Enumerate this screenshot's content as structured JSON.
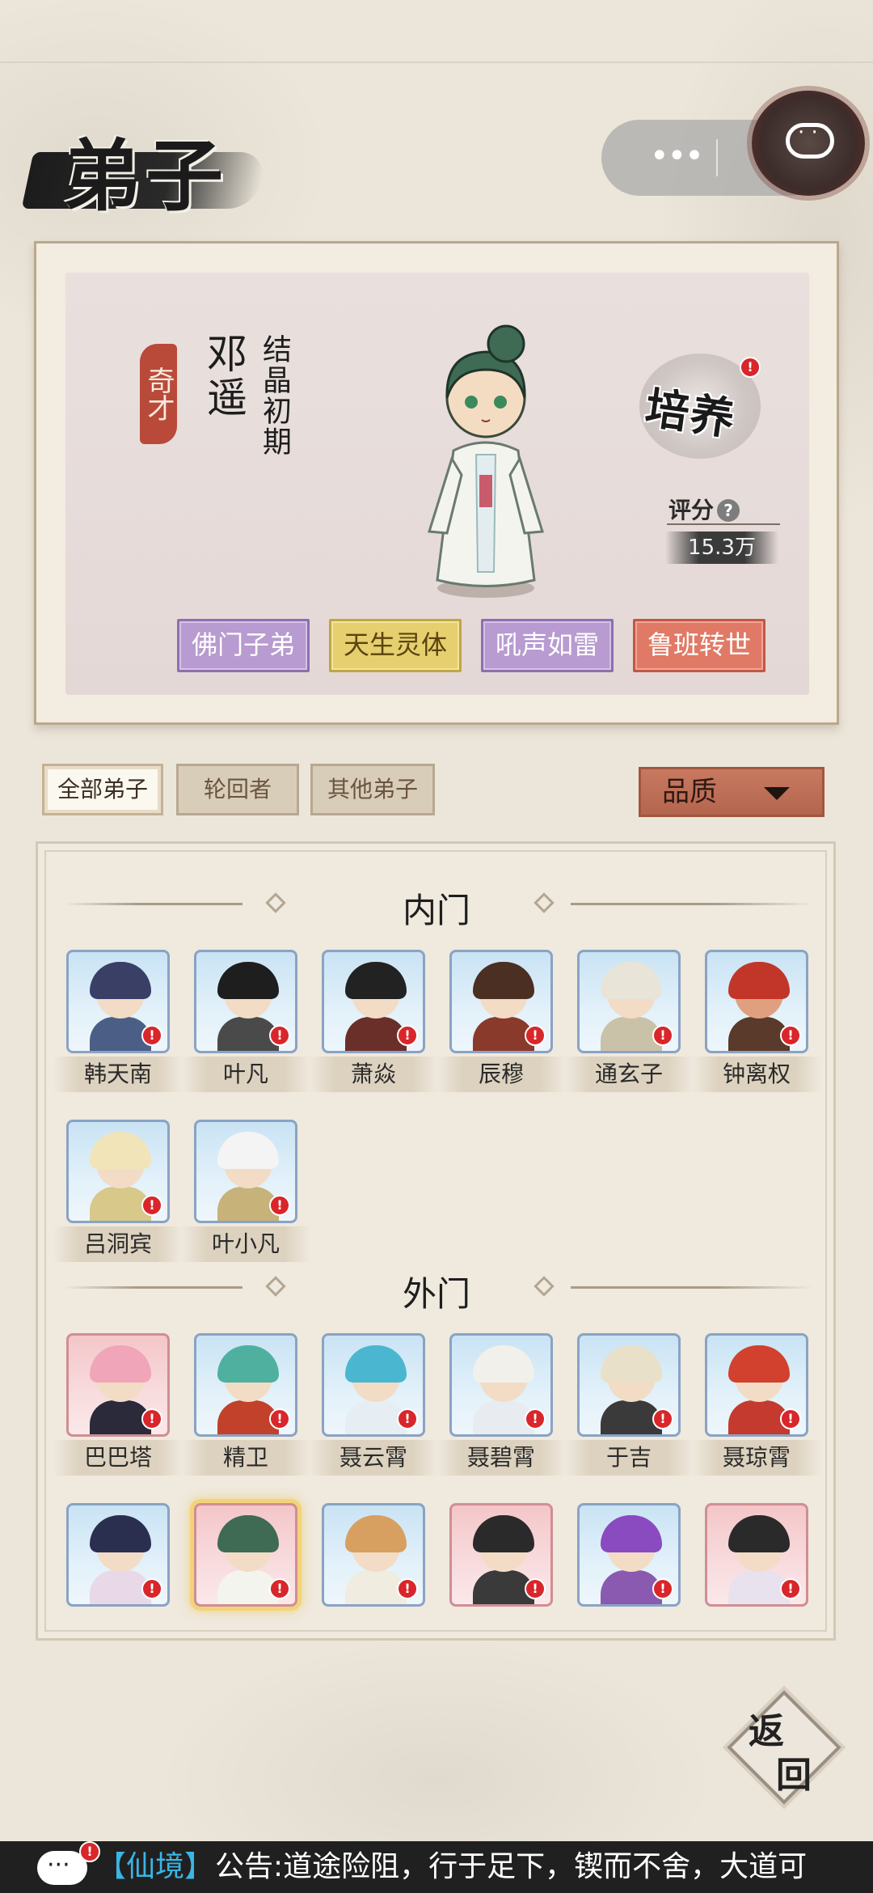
{
  "page": {
    "title": "弟子"
  },
  "profile": {
    "talent_seal": "奇才",
    "name": "邓遥",
    "realm": "结晶初期",
    "cultivate_label": "培养",
    "score_label": "评分",
    "score_help": "?",
    "score_value": "15.3万",
    "traits": [
      "佛门子弟",
      "天生灵体",
      "吼声如雷",
      "鲁班转世"
    ]
  },
  "filters": {
    "tabs": [
      "全部弟子",
      "轮回者",
      "其他弟子"
    ],
    "active_index": 0,
    "quality_label": "品质"
  },
  "sections": {
    "inner": {
      "title": "内门",
      "disciples": [
        "韩天南",
        "叶凡",
        "萧焱",
        "辰穆",
        "通玄子",
        "钟离权",
        "吕洞宾",
        "叶小凡"
      ]
    },
    "outer": {
      "title": "外门",
      "disciples": [
        "巴巴塔",
        "精卫",
        "聂云霄",
        "聂碧霄",
        "于吉",
        "聂琼霄"
      ]
    }
  },
  "return_button": {
    "line1": "返",
    "line2": "回"
  },
  "ticker": {
    "tag": "【仙境】",
    "message": "公告:道途险阻，行于足下，锲而不舍，大道可"
  },
  "colors": {
    "accent_red": "#d8262a",
    "trait_purple": "#b89bd0",
    "trait_gold": "#e6cf6e",
    "trait_red": "#e07a66",
    "tag_blue": "#39b6e6"
  }
}
